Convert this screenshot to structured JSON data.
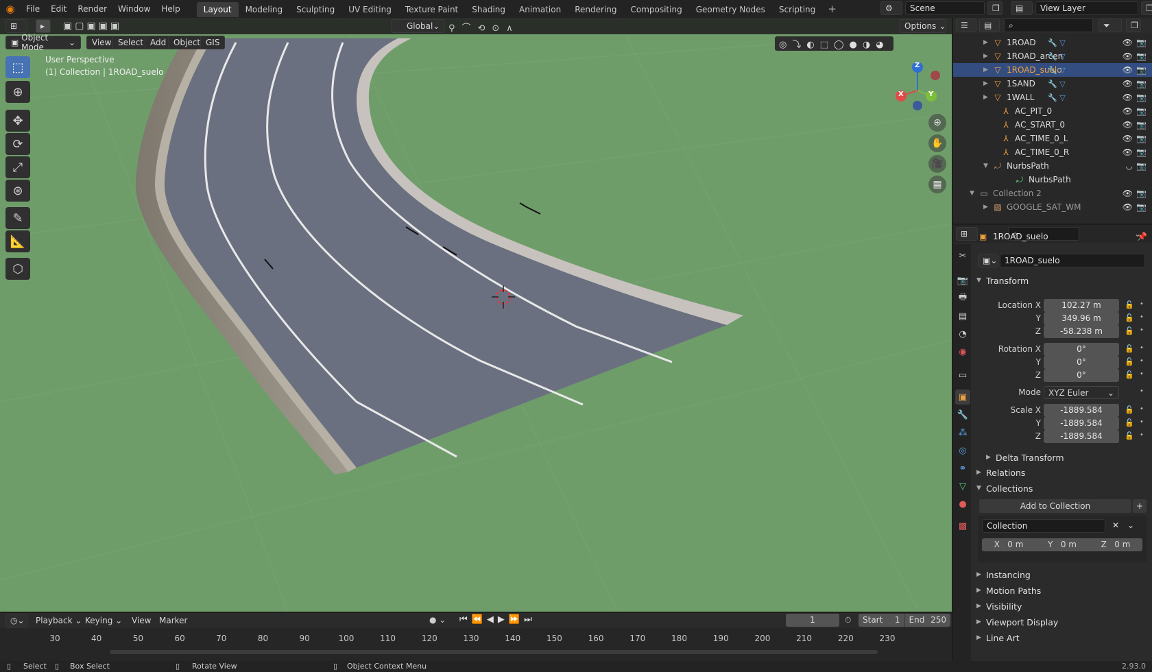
{
  "topbar": {
    "menus": [
      "File",
      "Edit",
      "Render",
      "Window",
      "Help"
    ],
    "workspaces": [
      "Layout",
      "Modeling",
      "Sculpting",
      "UV Editing",
      "Texture Paint",
      "Shading",
      "Animation",
      "Rendering",
      "Compositing",
      "Geometry Nodes",
      "Scripting"
    ],
    "active_workspace": "Layout",
    "scene": "Scene",
    "view_layer": "View Layer"
  },
  "viewport": {
    "mode": "Object Mode",
    "menus": [
      "View",
      "Select",
      "Add",
      "Object",
      "GIS"
    ],
    "orientation": "Global",
    "options_label": "Options",
    "perspective": "User Perspective",
    "collection_info": "(1) Collection | 1ROAD_suelo",
    "gizmo": {
      "x": "X",
      "y": "Y",
      "z": "Z"
    },
    "colors": {
      "ground": "#6f9d6a",
      "asphalt": "#6b7080",
      "curb": "#c8c2bf"
    }
  },
  "outliner": {
    "items": [
      {
        "name": "1ROAD",
        "type": "mesh",
        "selected": false
      },
      {
        "name": "1ROAD_arcen",
        "type": "mesh",
        "selected": false
      },
      {
        "name": "1ROAD_suelo",
        "type": "mesh",
        "selected": true
      },
      {
        "name": "1SAND",
        "type": "mesh",
        "selected": false
      },
      {
        "name": "1WALL",
        "type": "mesh",
        "selected": false
      },
      {
        "name": "AC_PIT_0",
        "type": "empty",
        "selected": false
      },
      {
        "name": "AC_START_0",
        "type": "empty",
        "selected": false
      },
      {
        "name": "AC_TIME_0_L",
        "type": "empty",
        "selected": false
      },
      {
        "name": "AC_TIME_0_R",
        "type": "empty",
        "selected": false
      },
      {
        "name": "NurbsPath",
        "type": "curve",
        "selected": false
      },
      {
        "name": "NurbsPath",
        "type": "curve-data",
        "selected": false
      },
      {
        "name": "Collection 2",
        "type": "collection",
        "selected": false
      },
      {
        "name": "GOOGLE_SAT_WM",
        "type": "image",
        "selected": false
      }
    ]
  },
  "properties": {
    "object_name": "1ROAD_suelo",
    "datablock": "1ROAD_suelo",
    "transform_title": "Transform",
    "location": {
      "label_x": "Location X",
      "x": "102.27 m",
      "y": "349.96 m",
      "z": "-58.238 m"
    },
    "rotation": {
      "label_x": "Rotation X",
      "x": "0°",
      "y": "0°",
      "z": "0°"
    },
    "mode_label": "Mode",
    "mode_value": "XYZ Euler",
    "scale": {
      "label_x": "Scale X",
      "x": "-1889.584",
      "y": "-1889.584",
      "z": "-1889.584"
    },
    "axis_y": "Y",
    "axis_z": "Z",
    "delta_transform": "Delta Transform",
    "relations": "Relations",
    "collections": "Collections",
    "add_to_collection": "Add to Collection",
    "collection_name": "Collection",
    "offset": {
      "x_label": "X",
      "x": "0 m",
      "y_label": "Y",
      "y": "0 m",
      "z_label": "Z",
      "z": "0 m"
    },
    "instancing": "Instancing",
    "motion_paths": "Motion Paths",
    "visibility": "Visibility",
    "viewport_display": "Viewport Display",
    "line_art": "Line Art"
  },
  "timeline": {
    "menus": [
      "Playback",
      "Keying",
      "View",
      "Marker"
    ],
    "current_frame": "1",
    "start_label": "Start",
    "start": "1",
    "end_label": "End",
    "end": "250",
    "ticks": [
      "30",
      "40",
      "50",
      "60",
      "70",
      "80",
      "90",
      "100",
      "110",
      "120",
      "130",
      "140",
      "150",
      "160",
      "170",
      "180",
      "190",
      "200",
      "210",
      "220",
      "230"
    ]
  },
  "statusbar": {
    "select": "Select",
    "box_select": "Box Select",
    "rotate_view": "Rotate View",
    "context_menu": "Object Context Menu",
    "version": "2.93.0"
  }
}
